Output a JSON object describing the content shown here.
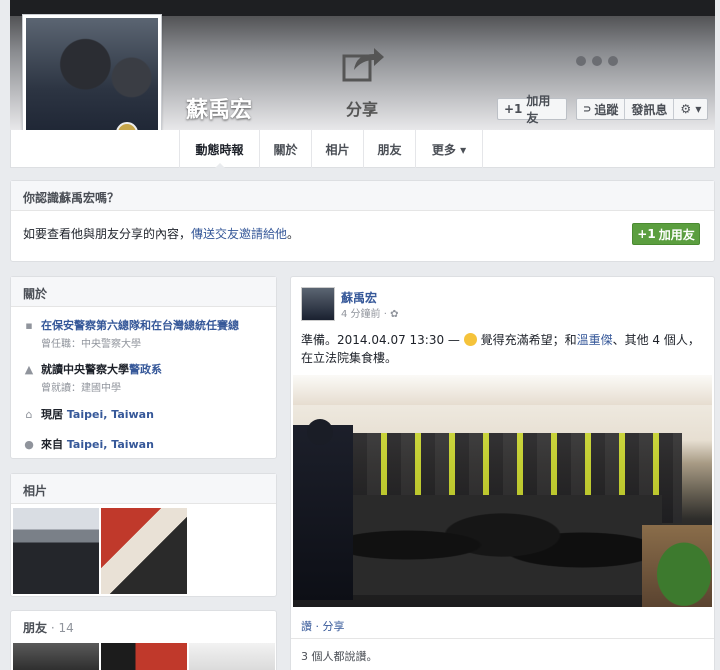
{
  "profile": {
    "name": "蘇禹宏",
    "share_label": "分享",
    "add_friend_label": "加用友",
    "follow_label": "追蹤",
    "message_label": "發訊息",
    "settings_icon": "gear-icon",
    "more_icon": "ellipsis-icon"
  },
  "nav": {
    "tabs": [
      {
        "label": "動態時報"
      },
      {
        "label": "關於"
      },
      {
        "label": "相片"
      },
      {
        "label": "朋友"
      },
      {
        "label": "更多 ▾"
      }
    ]
  },
  "know_box": {
    "heading": "你認識蘇禹宏嗎？",
    "text_prefix": "如要查看他與朋友分享的內容，",
    "text_link": "傳送交友邀請給他",
    "text_suffix": "。",
    "button_label": "加用友"
  },
  "about": {
    "heading": "關於",
    "items": [
      {
        "icon": "briefcase-icon",
        "prefix": "在保安警察第六總隊和在台灣總統任賽總",
        "link": "",
        "sub": "曾任職：中央警察大學"
      },
      {
        "icon": "graduation-cap-icon",
        "prefix": "就讀中央警察大學",
        "link": "警政系",
        "sub": "曾就讀：建國中學"
      },
      {
        "icon": "home-icon",
        "prefix": "現居 ",
        "link": "Taipei, Taiwan",
        "sub": ""
      },
      {
        "icon": "location-pin-icon",
        "prefix": "來自 ",
        "link": "Taipei, Taiwan",
        "sub": ""
      }
    ]
  },
  "photos": {
    "heading": "相片"
  },
  "friends": {
    "heading": "朋友",
    "separator": " · ",
    "count": "14"
  },
  "post": {
    "author": "蘇禹宏",
    "time": "4 分鐘前 · ",
    "text_prefix": "準備。2014.04.07 13:30 — ",
    "text_feeling": "覺得充滿希望；和",
    "text_link": "溫重傑",
    "text_mid": "、其他 4 個人，在立法院集食樓。",
    "actions": "讚 · 分享",
    "comments": "3 個人都說讚。"
  },
  "colors": {
    "link": "#365899",
    "green_button": "#5b9e3f",
    "background": "#e9ebee"
  }
}
